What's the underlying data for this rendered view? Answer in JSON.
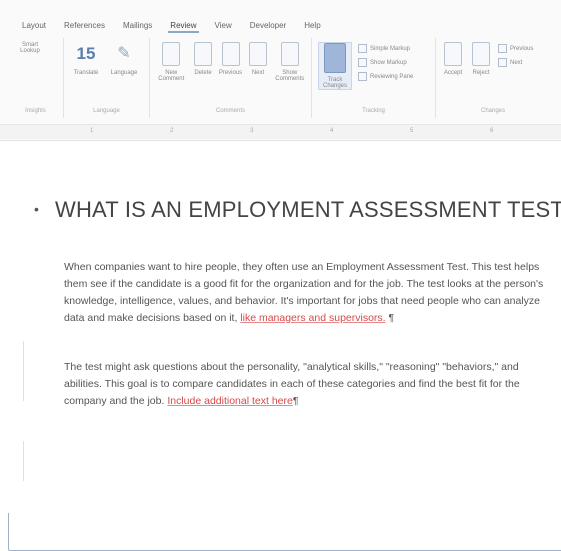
{
  "ribbon": {
    "tabs": [
      "Layout",
      "References",
      "Mailings",
      "Review",
      "View",
      "Developer",
      "Help"
    ],
    "active_tab_index": 3,
    "group1": {
      "button": "Smart Lookup",
      "label": "Insights"
    },
    "group2": {
      "num": "15",
      "num_label": "Translate",
      "lang_label": "Language",
      "label": "Language"
    },
    "group3": {
      "buttons": [
        "New Comment",
        "Delete",
        "Previous",
        "Next",
        "Show Comments"
      ],
      "label": "Comments"
    },
    "group4": {
      "track_label": "Track Changes",
      "opts": [
        "Simple Markup",
        "Show Markup",
        "Reviewing Pane"
      ],
      "label": "Tracking"
    },
    "group5": {
      "buttons": [
        "Accept",
        "Reject"
      ],
      "opts": [
        "Previous",
        "Next"
      ],
      "label": "Changes"
    }
  },
  "ruler": {
    "marks": [
      "1",
      "2",
      "3",
      "4",
      "5",
      "6"
    ]
  },
  "document": {
    "heading": "WHAT IS AN EMPLOYMENT ASSESSMENT TEST?",
    "pilcrow": "¶",
    "p1_text": "When companies want to hire people, they often use an Employment Assessment Test. This test helps them see if the candidate is a good fit for the organization and for the job. The test looks at the person's knowledge, intelligence, values, and behavior. It's important for jobs that need people who can analyze data and make decisions based on it, ",
    "p1_red": "like managers and supervisors.",
    "p2_text": "The test might ask questions about the personality, \"analytical skills,\" \"reasoning\" \"behaviors,\" and abilities. This goal is to compare candidates in each of these categories and find the best fit for the company and the job. ",
    "p2_red": "Include additional text here"
  }
}
